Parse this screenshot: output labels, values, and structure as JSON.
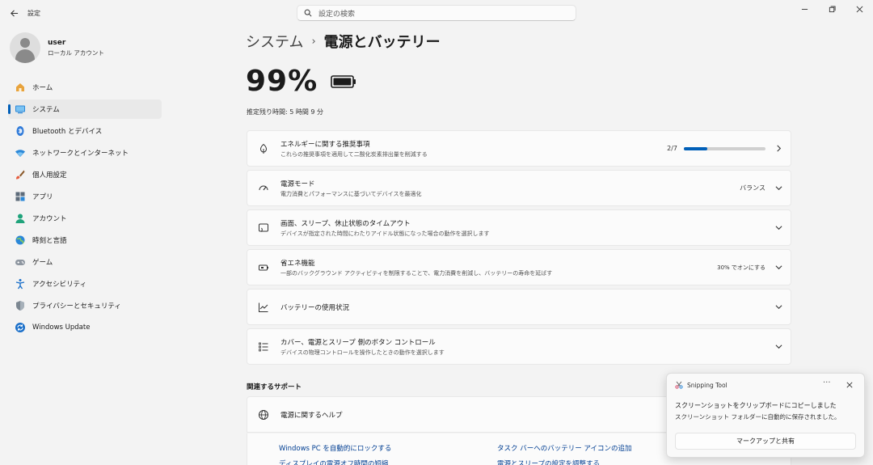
{
  "window": {
    "title": "設定"
  },
  "search": {
    "placeholder": "設定の検索"
  },
  "profile": {
    "name": "user",
    "account_type": "ローカル アカウント"
  },
  "sidebar": {
    "items": [
      {
        "label": "ホーム",
        "icon": "home-icon"
      },
      {
        "label": "システム",
        "icon": "system-icon",
        "active": true
      },
      {
        "label": "Bluetooth とデバイス",
        "icon": "bluetooth-icon"
      },
      {
        "label": "ネットワークとインターネット",
        "icon": "wifi-icon"
      },
      {
        "label": "個人用設定",
        "icon": "brush-icon"
      },
      {
        "label": "アプリ",
        "icon": "apps-icon"
      },
      {
        "label": "アカウント",
        "icon": "account-icon"
      },
      {
        "label": "時刻と言語",
        "icon": "globe-icon"
      },
      {
        "label": "ゲーム",
        "icon": "gamepad-icon"
      },
      {
        "label": "アクセシビリティ",
        "icon": "accessibility-icon"
      },
      {
        "label": "プライバシーとセキュリティ",
        "icon": "shield-icon"
      },
      {
        "label": "Windows Update",
        "icon": "update-icon"
      }
    ]
  },
  "breadcrumb": {
    "parent": "システム",
    "separator": "›",
    "current": "電源とバッテリー"
  },
  "battery": {
    "percent": "99%",
    "estimate": "推定残り時間: 5 時間 9 分",
    "level": 0.99
  },
  "cards": {
    "energy": {
      "title": "エネルギーに関する推奨事項",
      "desc": "これらの推奨事項を適用して二酸化炭素排出量を削減する",
      "progress_label": "2/7",
      "progress": 0.2857
    },
    "power_mode": {
      "title": "電源モード",
      "desc": "電力消費とパフォーマンスに基づいてデバイスを最適化",
      "value": "バランス"
    },
    "screen": {
      "title": "画面、スリープ、休止状態のタイムアウト",
      "desc": "デバイスが指定された時間にわたりアイドル状態になった場合の動作を選択します"
    },
    "saver": {
      "title": "省エネ機能",
      "desc": "一部のバックグラウンド アクティビティを制限することで、電力消費を削減し、バッテリーの寿命を延ばす",
      "value": "30% でオンにする"
    },
    "usage": {
      "title": "バッテリーの使用状況"
    },
    "buttons": {
      "title": "カバー、電源とスリープ 側のボタン コントロール",
      "desc": "デバイスの物理コントロールを操作したときの動作を選択します"
    }
  },
  "related": {
    "title": "関連するサポート",
    "help_title": "電源に関するヘルプ",
    "links": [
      "Windows PC を自動的にロックする",
      "タスク バーへのバッテリー アイコンの追加",
      "ディスプレイの電源オフ時間の短縮",
      "電源とスリープの設定を調整する"
    ]
  },
  "toast": {
    "app": "Snipping Tool",
    "more": "···",
    "message": "スクリーンショットをクリップボードにコピーしました",
    "submessage": "スクリーンショット フォルダーに自動的に保存されました。",
    "button": "マークアップと共有"
  },
  "colors": {
    "accent": "#005fb8",
    "link": "#003e92",
    "background": "#f3f3f3"
  }
}
